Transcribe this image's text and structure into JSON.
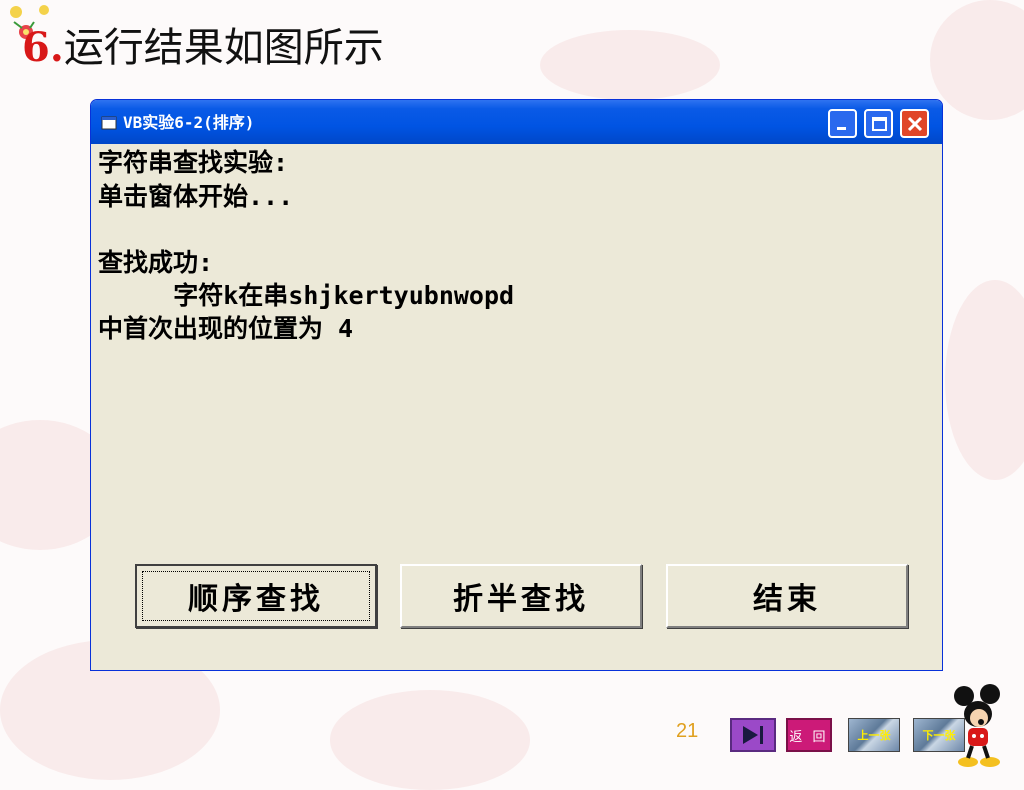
{
  "slide": {
    "title_number": "6.",
    "title_text": "运行结果如图所示",
    "page_number": "21"
  },
  "window": {
    "title": "VB实验6-2(排序)",
    "output_lines": [
      "字符串查找实验:",
      "单击窗体开始...",
      "",
      "查找成功:",
      "     字符k在串shjkertyubnwopd",
      "中首次出现的位置为 4"
    ],
    "buttons": {
      "sequential": "顺序查找",
      "binary": "折半查找",
      "end": "结束"
    }
  },
  "nav": {
    "return_label": "返 回",
    "prev_label": "上一张",
    "next_label": "下一张"
  },
  "colors": {
    "titlebar": "#0054e3",
    "window_bg": "#ece9d8",
    "close": "#e04628",
    "title_number": "#d81818"
  }
}
